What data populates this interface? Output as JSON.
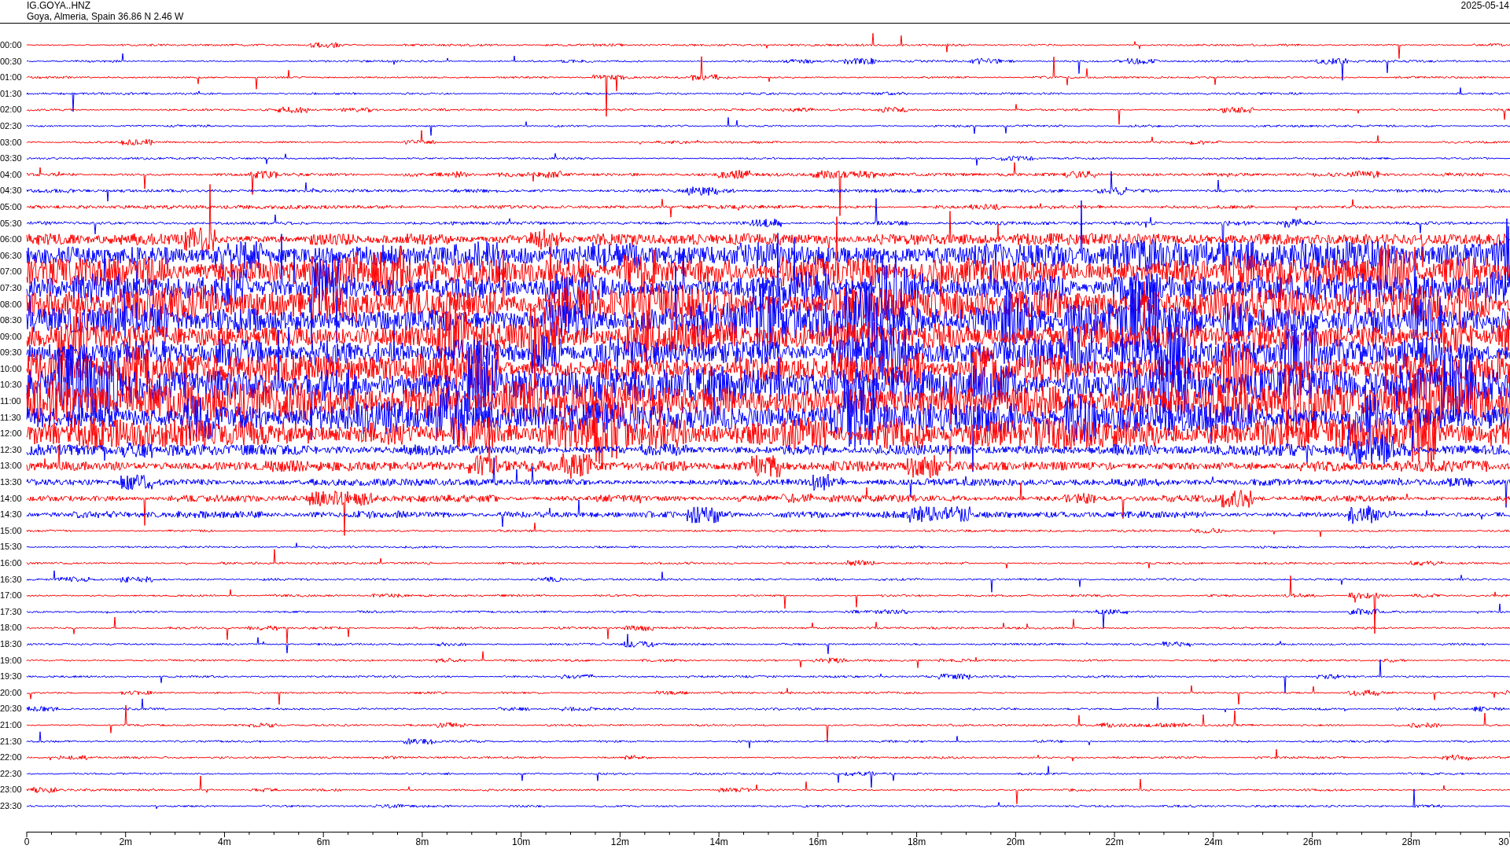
{
  "header": {
    "station": "IG.GOYA..HNZ",
    "location": "Goya, Almeria, Spain  36.86 N 2.46 W",
    "date": "2025-05-14"
  },
  "rows": [
    {
      "time": "00:00"
    },
    {
      "time": "00:30"
    },
    {
      "time": "01:00"
    },
    {
      "time": "01:30"
    },
    {
      "time": "02:00"
    },
    {
      "time": "02:30"
    },
    {
      "time": "03:00"
    },
    {
      "time": "03:30"
    },
    {
      "time": "04:00"
    },
    {
      "time": "04:30"
    },
    {
      "time": "05:00"
    },
    {
      "time": "05:30"
    },
    {
      "time": "06:00"
    },
    {
      "time": "06:30"
    },
    {
      "time": "07:00"
    },
    {
      "time": "07:30"
    },
    {
      "time": "08:00"
    },
    {
      "time": "08:30"
    },
    {
      "time": "09:00"
    },
    {
      "time": "09:30"
    },
    {
      "time": "10:00"
    },
    {
      "time": "10:30"
    },
    {
      "time": "11:00"
    },
    {
      "time": "11:30"
    },
    {
      "time": "12:00"
    },
    {
      "time": "12:30"
    },
    {
      "time": "13:00"
    },
    {
      "time": "13:30"
    },
    {
      "time": "14:00"
    },
    {
      "time": "14:30"
    },
    {
      "time": "15:00"
    },
    {
      "time": "15:30"
    },
    {
      "time": "16:00"
    },
    {
      "time": "16:30"
    },
    {
      "time": "17:00"
    },
    {
      "time": "17:30"
    },
    {
      "time": "18:00"
    },
    {
      "time": "18:30"
    },
    {
      "time": "19:00"
    },
    {
      "time": "19:30"
    },
    {
      "time": "20:00"
    },
    {
      "time": "20:30"
    },
    {
      "time": "21:00"
    },
    {
      "time": "21:30"
    },
    {
      "time": "22:00"
    },
    {
      "time": "22:30"
    },
    {
      "time": "23:00"
    },
    {
      "time": "23:30"
    }
  ],
  "axis": {
    "labels": [
      "0",
      "2m",
      "4m",
      "6m",
      "8m",
      "10m",
      "12m",
      "14m",
      "16m",
      "18m",
      "20m",
      "22m",
      "24m",
      "26m",
      "28m",
      "30"
    ]
  }
}
